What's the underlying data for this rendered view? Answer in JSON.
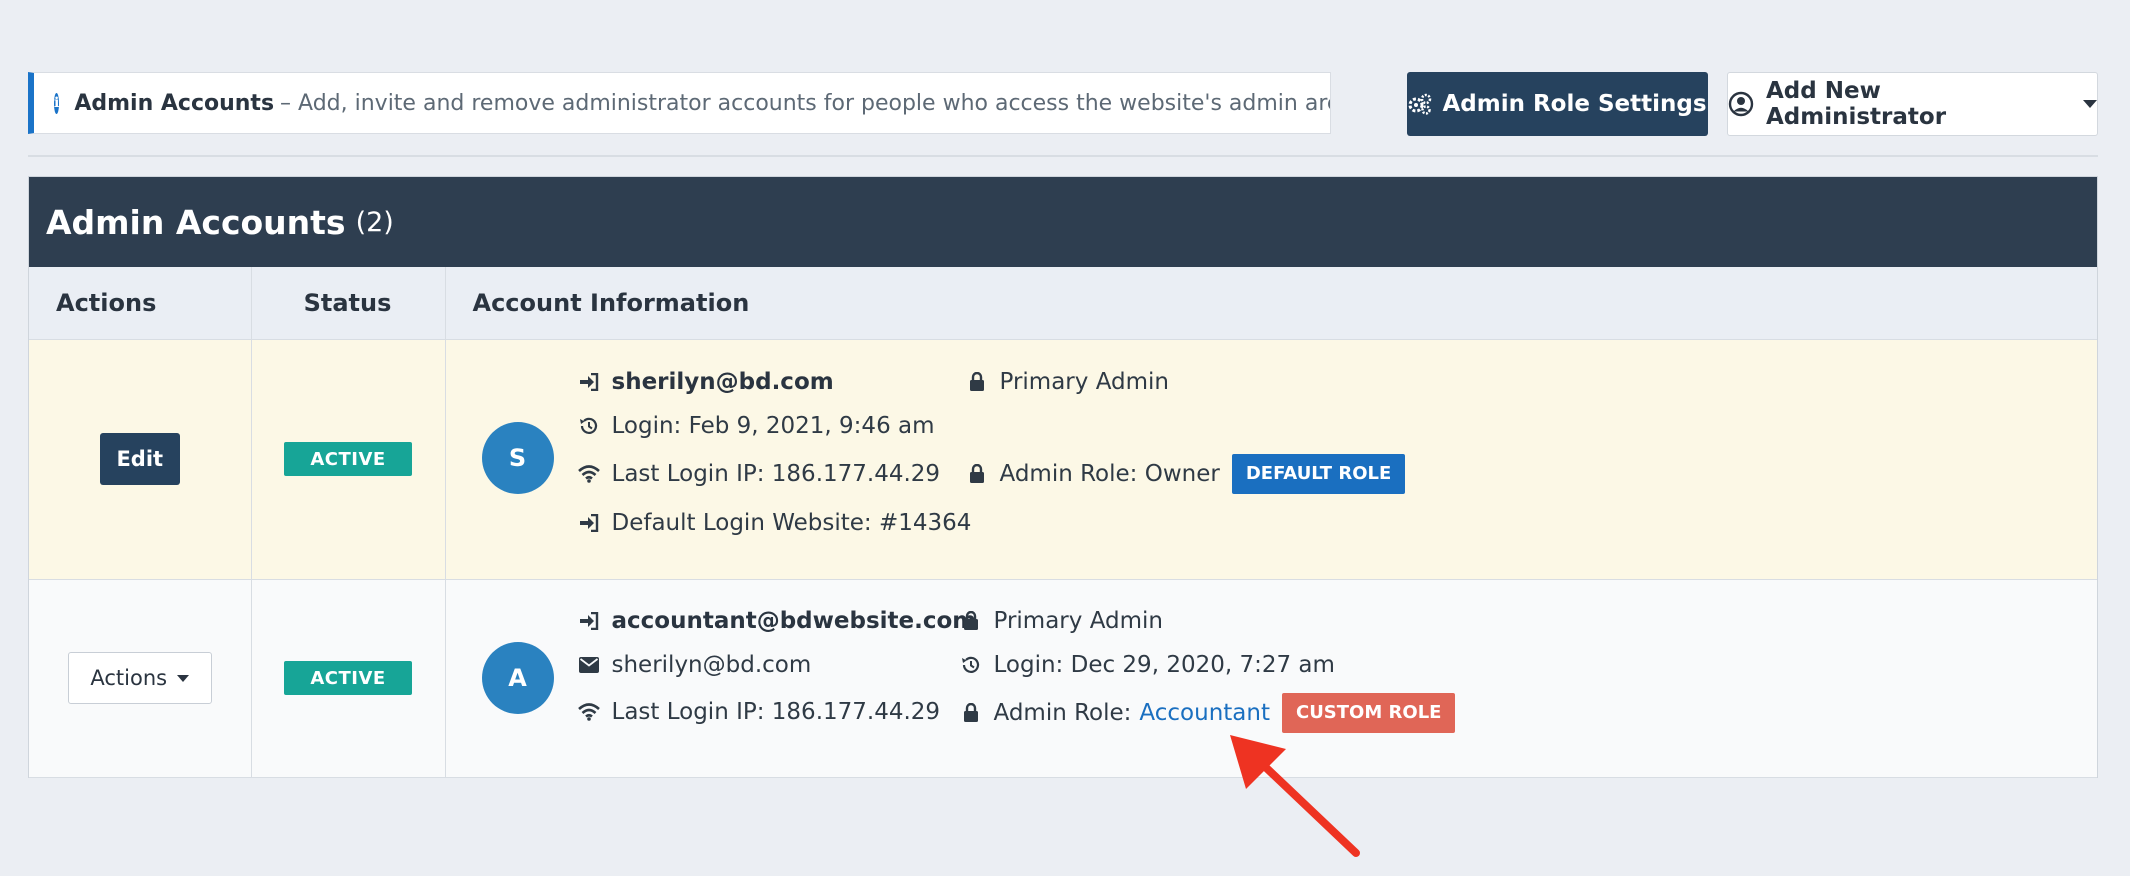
{
  "banner": {
    "title": "Admin Accounts",
    "description": "– Add, invite and remove administrator accounts for people who access the website's admin area"
  },
  "buttons": {
    "role_settings": "Admin Role Settings",
    "add_admin": "Add New Administrator"
  },
  "panel": {
    "title": "Admin Accounts",
    "count": "(2)"
  },
  "table": {
    "headers": [
      "Actions",
      "Status",
      "Account Information"
    ],
    "rows": [
      {
        "action_label": "Edit",
        "status": "ACTIVE",
        "avatar_letter": "S",
        "email": "sherilyn@bd.com",
        "login": "Login: Feb 9, 2021, 9:46 am",
        "last_ip": "Last Login IP: 186.177.44.29",
        "default_site": "Default Login Website: #14364",
        "primary": "Primary Admin",
        "role_text": "Admin Role: Owner",
        "role_badge": "DEFAULT ROLE"
      },
      {
        "action_label": "Actions",
        "status": "ACTIVE",
        "avatar_letter": "A",
        "email": "accountant@bdwebsite.com",
        "secondary_email": "sherilyn@bd.com",
        "last_ip": "Last Login IP: 186.177.44.29",
        "primary": "Primary Admin",
        "login": "Login: Dec 29, 2020, 7:27 am",
        "role_text": "Admin Role:",
        "role_link": "Accountant",
        "role_badge": "CUSTOM ROLE"
      }
    ]
  },
  "colors": {
    "header_bg": "#2e3e50",
    "primary_button": "#26425e",
    "active_badge": "#17a597",
    "default_badge": "#1a6fc0",
    "custom_badge": "#e06657",
    "highlight_row": "#fcf8e6",
    "annotation_arrow": "#ee3322"
  },
  "icons": [
    "info-icon",
    "gears-icon",
    "user-circle-icon",
    "caret-down-icon",
    "sign-in-icon",
    "history-icon",
    "wifi-icon",
    "lock-icon",
    "envelope-icon",
    "annotation-arrow"
  ]
}
